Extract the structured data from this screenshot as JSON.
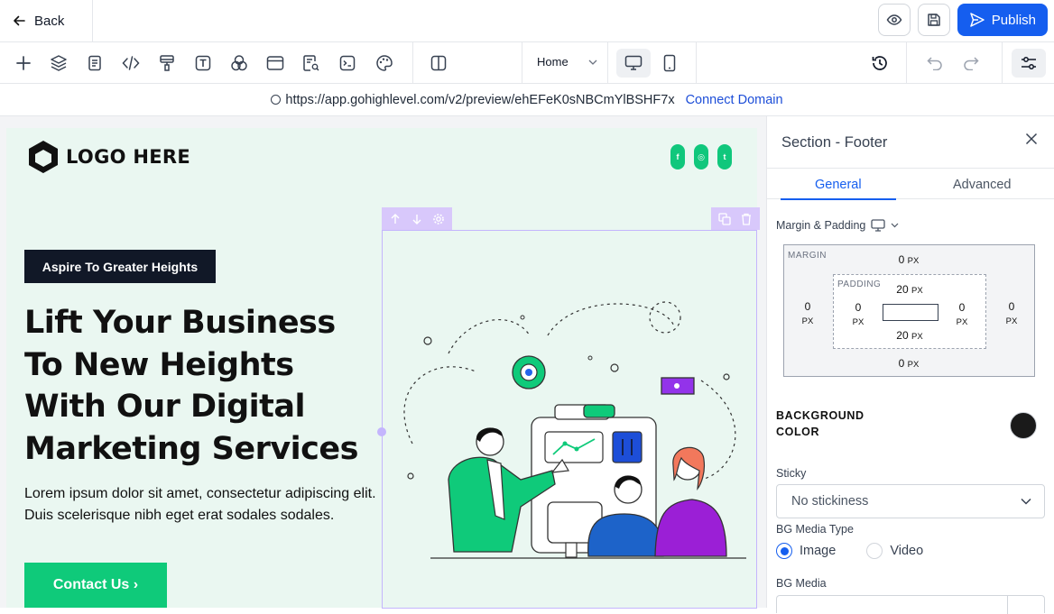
{
  "topbar": {
    "back_label": "Back",
    "publish_label": "Publish",
    "preview_icon": "eye-icon",
    "save_icon": "save-icon"
  },
  "toolbar": {
    "tools": [
      "add-icon",
      "layers-icon",
      "pages-icon",
      "code-icon",
      "styles-icon",
      "text-icon",
      "elements-icon",
      "sections-icon",
      "seo-icon",
      "terminal-icon",
      "color-palette-icon",
      "split-view-icon"
    ],
    "page_select": "Home",
    "devices": [
      "desktop-icon",
      "mobile-icon"
    ],
    "history_icon": "history-icon",
    "undo_icon": "undo-icon",
    "redo_icon": "redo-icon",
    "settings_icon": "settings-sliders-icon"
  },
  "urlbar": {
    "url": "https://app.gohighlevel.com/v2/preview/ehEFeK0sNBCmYlBSHF7x",
    "connect_label": "Connect Domain"
  },
  "page": {
    "logo_text": "LOGO HERE",
    "socials": [
      "f",
      "◎",
      "t"
    ],
    "tag": "Aspire To Greater Heights",
    "headline": [
      "Lift Your Business",
      "To New Heights",
      "With Our Digital",
      "Marketing Services"
    ],
    "body": "Lorem ipsum dolor sit amet, consectetur adipiscing elit. Duis scelerisque nibh eget erat sodales sodales.",
    "cta": "Contact Us ›"
  },
  "panel": {
    "title": "Section - Footer",
    "tabs": [
      "General",
      "Advanced"
    ],
    "margin_padding_label": "Margin & Padding",
    "margin_label": "MARGIN",
    "padding_label": "PADDING",
    "margin": {
      "top": "0",
      "bottom": "0",
      "left": "0",
      "right": "0"
    },
    "padding": {
      "top": "20",
      "bottom": "20",
      "left": "0",
      "right": "0"
    },
    "unit": "PX",
    "bg_color_label_1": "BACKGROUND",
    "bg_color_label_2": "COLOR",
    "bg_color": "#1a1a1a",
    "sticky_label": "Sticky",
    "sticky_value": "No stickiness",
    "bg_media_type_label": "BG Media Type",
    "media_options": [
      "Image",
      "Video"
    ],
    "media_selected": "Image",
    "bg_media_label": "BG Media"
  },
  "colors": {
    "accent": "#155eef",
    "brand_green": "#0fca7a",
    "canvas_bg": "#eaf7f1",
    "selection": "#c4b5fd"
  }
}
